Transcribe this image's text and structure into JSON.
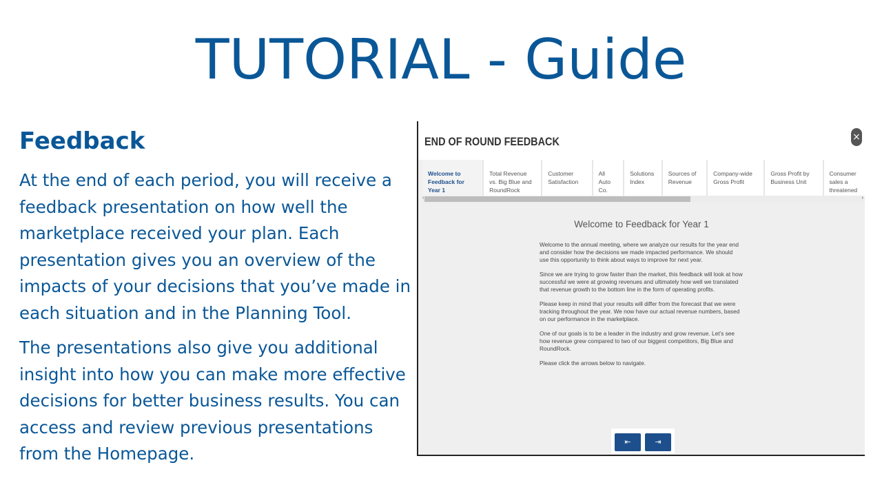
{
  "slide": {
    "title": "TUTORIAL - Guide",
    "heading": "Feedback",
    "paragraph1": "At the end of each period, you will receive a feedback presentation on how well the marketplace received your plan. Each presentation gives you an overview of the impacts of your decisions that you’ve made in each situation and in the Planning Tool.",
    "paragraph2": "The presentations also give you additional insight into how you can make more effective decisions for better business results. You can access and review previous presentations from the Homepage."
  },
  "screenshot": {
    "title": "END OF ROUND FEEDBACK",
    "close_icon": "×",
    "tabs": [
      {
        "label": "Welcome to Feedback for Year 1",
        "active": true
      },
      {
        "label": "Total Revenue vs. Big Blue and RoundRock"
      },
      {
        "label": "Customer Satisfaction"
      },
      {
        "label": "All Auto Co."
      },
      {
        "label": "Solutions Index"
      },
      {
        "label": "Sources of Revenue"
      },
      {
        "label": "Company-wide Gross Profit"
      },
      {
        "label": "Gross Profit by Business Unit"
      },
      {
        "label": "Consumer sales a threatened"
      }
    ],
    "content_title": "Welcome to Feedback for Year 1",
    "content": [
      "Welcome to the annual meeting, where we analyze our results for the year end and consider how the decisions we made impacted performance. We should use this opportunity to think about ways to improve for next year.",
      "Since we are trying to grow faster than the market, this feedback will look at how successful we were at growing revenues and ultimately how well we translated that revenue growth to the bottom line in the form of operating profits.",
      "Please keep in mind that your results will differ from the forecast that we were tracking throughout the year. We now have our actual revenue numbers, based on our performance in the marketplace.",
      "One of our goals is to be a leader in the industry and grow revenue. Let’s see how revenue grew compared to two of our biggest competitors, Big Blue and RoundRock.",
      "Please click the arrows below to navigate."
    ],
    "prev_icon": "⇤",
    "next_icon": "⇥"
  }
}
